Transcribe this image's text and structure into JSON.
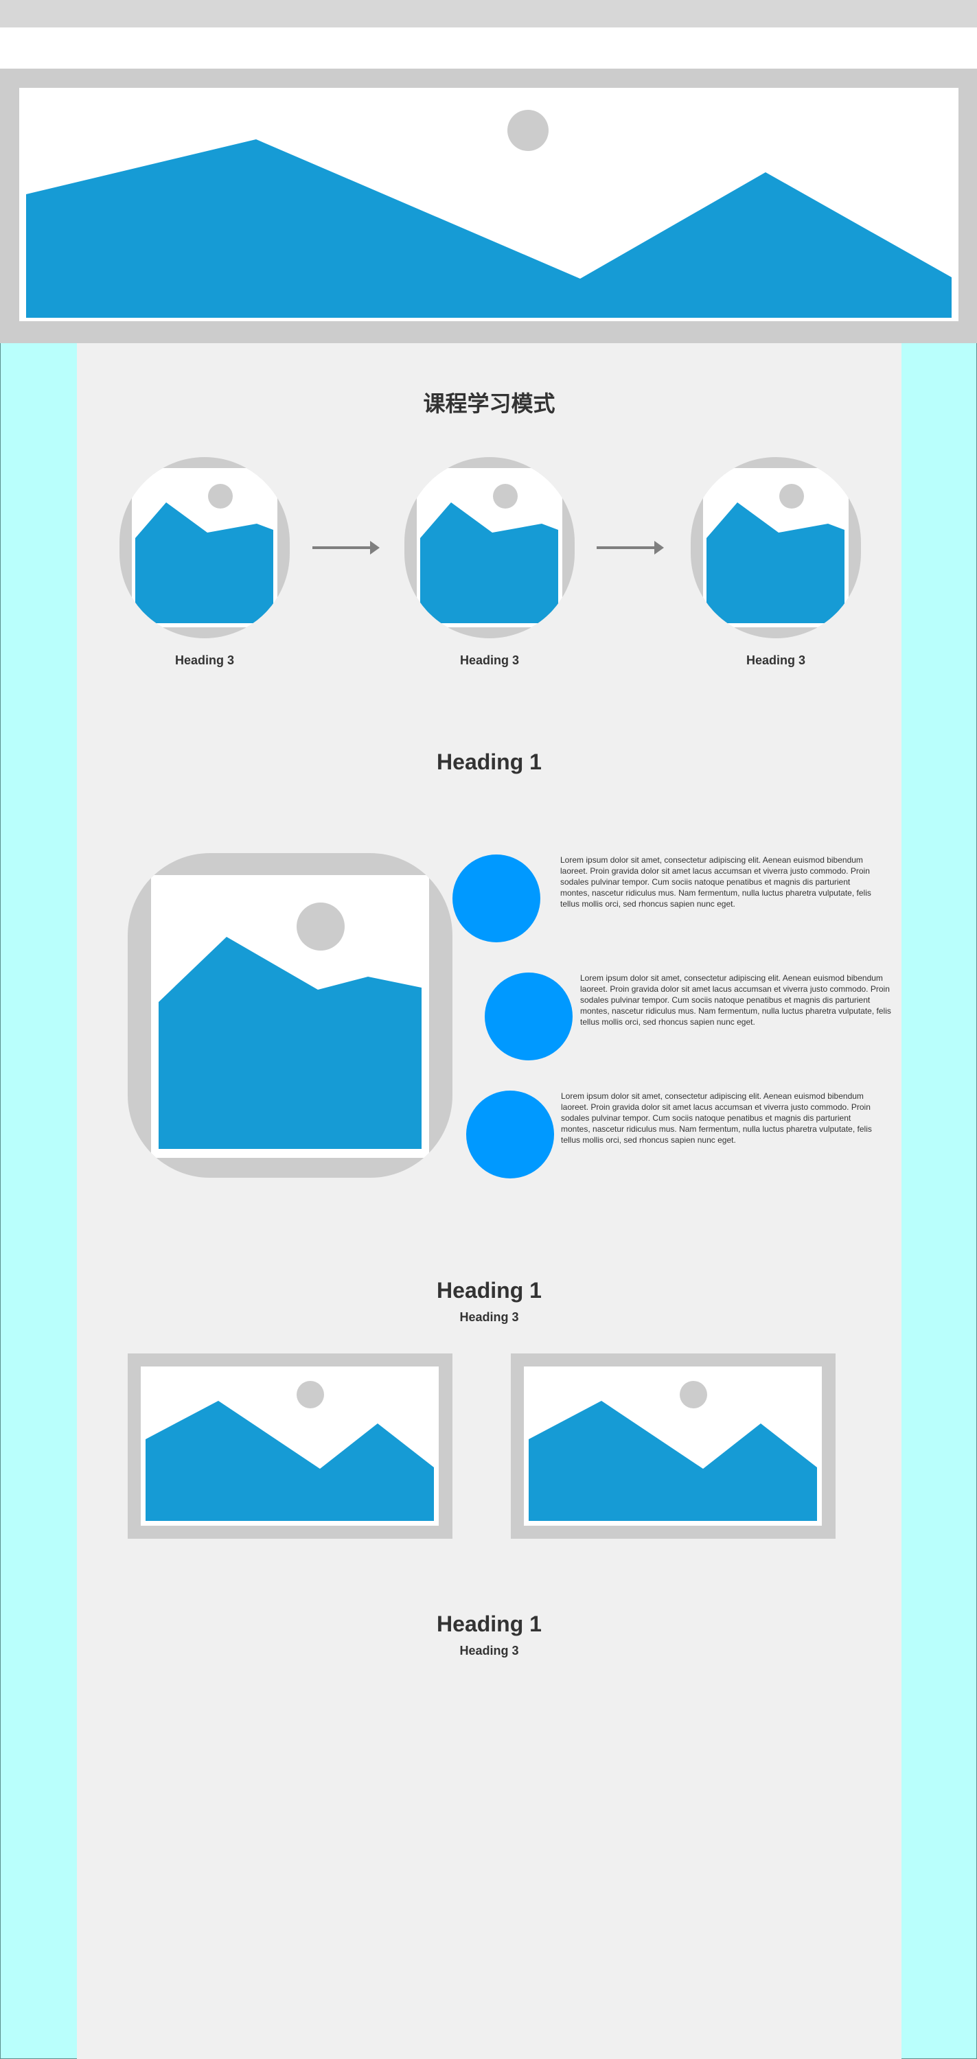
{
  "section_title": "课程学习模式",
  "process_steps": [
    {
      "heading": "Heading 3"
    },
    {
      "heading": "Heading 3"
    },
    {
      "heading": "Heading 3"
    }
  ],
  "features_section": {
    "heading": "Heading 1",
    "items": [
      {
        "text": "Lorem ipsum dolor sit amet, consectetur adipiscing elit. Aenean euismod bibendum laoreet. Proin gravida dolor sit amet lacus accumsan et viverra justo commodo. Proin sodales pulvinar tempor. Cum sociis natoque penatibus et magnis dis parturient montes, nascetur ridiculus mus. Nam fermentum, nulla luctus pharetra vulputate, felis tellus mollis orci, sed rhoncus sapien nunc eget."
      },
      {
        "text": "Lorem ipsum dolor sit amet, consectetur adipiscing elit. Aenean euismod bibendum laoreet. Proin gravida dolor sit amet lacus accumsan et viverra justo commodo. Proin sodales pulvinar tempor. Cum sociis natoque penatibus et magnis dis parturient montes, nascetur ridiculus mus. Nam fermentum, nulla luctus pharetra vulputate, felis tellus mollis orci, sed rhoncus sapien nunc eget."
      },
      {
        "text": "Lorem ipsum dolor sit amet, consectetur adipiscing elit. Aenean euismod bibendum laoreet. Proin gravida dolor sit amet lacus accumsan et viverra justo commodo. Proin sodales pulvinar tempor. Cum sociis natoque penatibus et magnis dis parturient montes, nascetur ridiculus mus. Nam fermentum, nulla luctus pharetra vulputate, felis tellus mollis orci, sed rhoncus sapien nunc eget."
      }
    ]
  },
  "gallery_section": {
    "heading": "Heading 1",
    "subheading": "Heading 3"
  },
  "bottom_section": {
    "heading": "Heading 1",
    "subheading": "Heading 3"
  },
  "colors": {
    "placeholder_fill": "#169bd5",
    "placeholder_frame": "#cccccc",
    "accent_dot": "#0099ff",
    "side_panel": "#b9fffc",
    "main_background": "#f0f0f0",
    "text": "#333333"
  }
}
